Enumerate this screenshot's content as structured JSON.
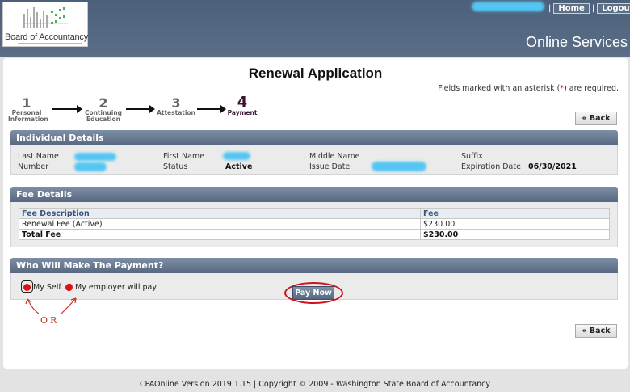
{
  "header": {
    "logo_text": "Board of Accountancy",
    "site_title": "Online Services",
    "nav": {
      "separator": "|",
      "home_label": "Home",
      "logout_label": "Logout"
    }
  },
  "page": {
    "title": "Renewal Application",
    "required_note_pre": "Fields marked with an asterisk (",
    "required_note_ast": "*",
    "required_note_post": ") are required.",
    "back_label": "« Back"
  },
  "steps": [
    {
      "num": "1",
      "label_lines": [
        "Personal",
        "Information"
      ]
    },
    {
      "num": "2",
      "label_lines": [
        "Continuing",
        "Education"
      ]
    },
    {
      "num": "3",
      "label_lines": [
        "Attestation"
      ]
    },
    {
      "num": "4",
      "label_lines": [
        "Payment"
      ],
      "active": true
    }
  ],
  "individual": {
    "heading": "Individual Details",
    "last_name_label": "Last Name",
    "first_name_label": "First Name",
    "middle_name_label": "Middle Name",
    "suffix_label": "Suffix",
    "number_label": "Number",
    "status_label": "Status",
    "status_value": "Active",
    "issue_date_label": "Issue Date",
    "expiration_label": "Expiration Date",
    "expiration_value": "06/30/2021"
  },
  "fees": {
    "heading": "Fee Details",
    "col_desc": "Fee Description",
    "col_fee": "Fee",
    "rows": [
      {
        "desc": "Renewal Fee (Active)",
        "fee": "$230.00"
      }
    ],
    "total_label": "Total Fee",
    "total_value": "$230.00"
  },
  "payment": {
    "heading": "Who Will Make The Payment?",
    "option_self": "My Self",
    "option_employer": "My employer will pay",
    "annotation": "OR",
    "pay_label": "Pay Now"
  },
  "footer": {
    "text": "CPAOnline Version 2019.1.15 | Copyright © 2009 - Washington State Board of Accountancy"
  },
  "colors": {
    "header_bg": "#4d6079",
    "section_header": "#56677f",
    "annotation_red": "#d0121b",
    "redaction_blue": "#54c6f2"
  }
}
